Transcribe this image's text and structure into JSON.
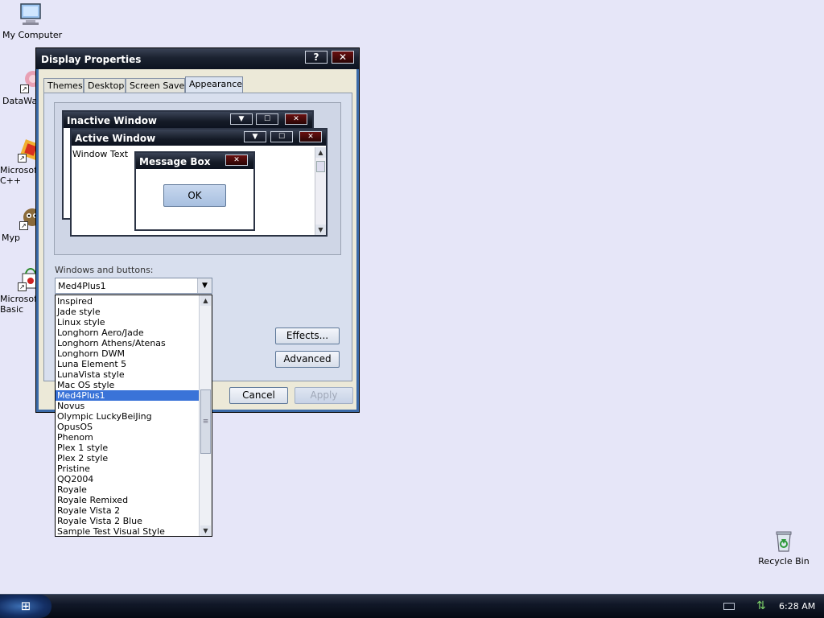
{
  "desktop": {
    "icons": [
      {
        "name": "my-computer-icon",
        "label": "My Computer"
      },
      {
        "name": "datawarp-icon",
        "label": "DataWar"
      },
      {
        "name": "microsoft-cpp-icon",
        "label": "Microsoft C++"
      },
      {
        "name": "myp-icon",
        "label": "Myp"
      },
      {
        "name": "microsoft-basic-icon",
        "label": "Microsoft Basic"
      },
      {
        "name": "recycle-bin-icon",
        "label": "Recycle Bin"
      }
    ]
  },
  "window": {
    "title": "Display Properties",
    "help_glyph": "?",
    "close_glyph": "✕",
    "tabs": [
      "Themes",
      "Desktop",
      "Screen Saver",
      "Appearance"
    ],
    "active_tab": "Appearance",
    "preview": {
      "inactive_title": "Inactive Window",
      "active_title": "Active Window",
      "window_text": "Window Text",
      "message_box_title": "Message Box",
      "ok_label": "OK"
    },
    "windows_and_buttons_label": "Windows and buttons:",
    "selected_style": "Med4Plus1",
    "effects_label": "Effects...",
    "advanced_label": "Advanced",
    "cancel_label": "Cancel",
    "apply_label": "Apply"
  },
  "style_list": [
    "Inspired",
    "Jade style",
    "Linux style",
    "Longhorn Aero/Jade",
    "Longhorn Athens/Atenas",
    "Longhorn DWM",
    "Luna Element 5",
    "LunaVista style",
    "Mac OS style",
    "Med4Plus1",
    "Novus",
    "Olympic LuckyBeiJing",
    "OpusOS",
    "Phenom",
    "Plex 1 style",
    "Plex 2 style",
    "Pristine",
    "QQ2004",
    "Royale",
    "Royale Remixed",
    "Royale Vista 2",
    "Royale Vista 2 Blue",
    "Sample Test Visual Style"
  ],
  "taskbar": {
    "clock": "6:28 AM"
  },
  "colors": {
    "desktop": "#e6e6f8",
    "selection": "#3a73d8",
    "title_dark": "#0d1320"
  }
}
